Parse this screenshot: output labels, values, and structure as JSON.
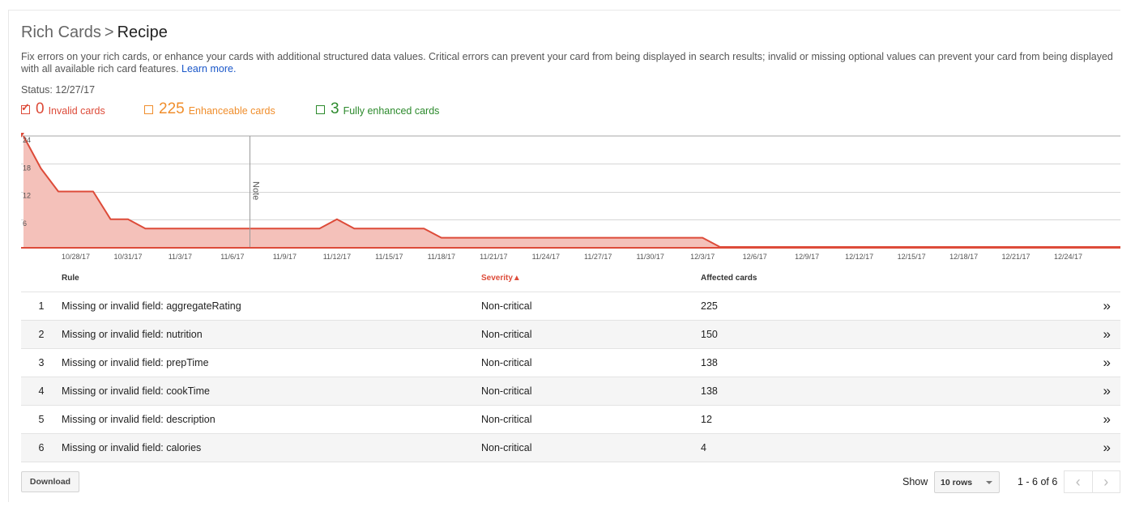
{
  "header": {
    "breadcrumb_parent": "Rich Cards",
    "breadcrumb_separator": ">",
    "title": "Recipe",
    "description": "Fix errors on your rich cards, or enhance your cards with additional structured data values. Critical errors can prevent your card from being displayed in search results; invalid or missing optional values can prevent your card from being displayed with all available rich card features.",
    "learn_more": "Learn more.",
    "status": "Status: 12/27/17"
  },
  "filters": [
    {
      "count": "0",
      "label": "Invalid cards",
      "checked": true,
      "color": "#dd4b39"
    },
    {
      "count": "225",
      "label": "Enhanceable cards",
      "checked": false,
      "color": "#f08e2c"
    },
    {
      "count": "3",
      "label": "Fully enhanced cards",
      "checked": false,
      "color": "#2c8a2c"
    }
  ],
  "chart_data": {
    "type": "area",
    "title": "",
    "xlabel": "",
    "ylabel": "",
    "ylim": [
      0,
      24
    ],
    "y_ticks": [
      "6",
      "12",
      "18",
      "24"
    ],
    "x_tick_labels": [
      "10/28/17",
      "10/31/17",
      "11/3/17",
      "11/6/17",
      "11/9/17",
      "11/12/17",
      "11/15/17",
      "11/18/17",
      "11/21/17",
      "11/24/17",
      "11/27/17",
      "11/30/17",
      "12/3/17",
      "12/6/17",
      "12/9/17",
      "12/12/17",
      "12/15/17",
      "12/18/17",
      "12/21/17",
      "12/24/17"
    ],
    "x": [
      "10/25/17",
      "10/26/17",
      "10/27/17",
      "10/28/17",
      "10/29/17",
      "10/30/17",
      "10/31/17",
      "11/1/17",
      "11/2/17",
      "11/3/17",
      "11/4/17",
      "11/5/17",
      "11/6/17",
      "11/7/17",
      "11/8/17",
      "11/9/17",
      "11/10/17",
      "11/11/17",
      "11/12/17",
      "11/13/17",
      "11/14/17",
      "11/15/17",
      "11/16/17",
      "11/17/17",
      "11/18/17",
      "11/19/17",
      "11/20/17",
      "11/21/17",
      "11/22/17",
      "11/23/17",
      "11/24/17",
      "11/25/17",
      "11/26/17",
      "11/27/17",
      "11/28/17",
      "11/29/17",
      "11/30/17",
      "12/1/17",
      "12/2/17",
      "12/3/17",
      "12/4/17",
      "12/5/17",
      "12/6/17",
      "12/7/17",
      "12/8/17",
      "12/9/17",
      "12/10/17",
      "12/11/17",
      "12/12/17",
      "12/13/17",
      "12/14/17",
      "12/15/17",
      "12/16/17",
      "12/17/17",
      "12/18/17",
      "12/19/17",
      "12/20/17",
      "12/21/17",
      "12/22/17",
      "12/23/17",
      "12/24/17",
      "12/25/17",
      "12/26/17",
      "12/27/17"
    ],
    "series": [
      {
        "name": "",
        "color": "#dd4b39",
        "values": [
          24,
          17,
          12,
          12,
          12,
          6,
          6,
          4,
          4,
          4,
          4,
          4,
          4,
          4,
          4,
          4,
          4,
          4,
          6,
          4,
          4,
          4,
          4,
          4,
          2,
          2,
          2,
          2,
          2,
          2,
          2,
          2,
          2,
          2,
          2,
          2,
          2,
          2,
          2,
          2,
          0,
          0,
          0,
          0,
          0,
          0,
          0,
          0,
          0,
          0,
          0,
          0,
          0,
          0,
          0,
          0,
          0,
          0,
          0,
          0,
          0,
          0,
          0,
          0
        ]
      }
    ],
    "annotation": {
      "label": "Note",
      "x": "11/7/17"
    },
    "grid": true
  },
  "table": {
    "columns": {
      "rule": "Rule",
      "severity": "Severity",
      "sort_indicator": "▲",
      "affected": "Affected cards"
    },
    "rows": [
      {
        "index": "1",
        "rule": "Missing or invalid field: aggregateRating",
        "severity": "Non-critical",
        "affected": "225"
      },
      {
        "index": "2",
        "rule": "Missing or invalid field: nutrition",
        "severity": "Non-critical",
        "affected": "150"
      },
      {
        "index": "3",
        "rule": "Missing or invalid field: prepTime",
        "severity": "Non-critical",
        "affected": "138"
      },
      {
        "index": "4",
        "rule": "Missing or invalid field: cookTime",
        "severity": "Non-critical",
        "affected": "138"
      },
      {
        "index": "5",
        "rule": "Missing or invalid field: description",
        "severity": "Non-critical",
        "affected": "12"
      },
      {
        "index": "6",
        "rule": "Missing or invalid field: calories",
        "severity": "Non-critical",
        "affected": "4"
      }
    ],
    "row_action_glyph": "»"
  },
  "footer": {
    "download_label": "Download",
    "show_label": "Show",
    "rows_select": "10 rows",
    "range_text": "1 - 6 of 6",
    "prev_glyph": "‹",
    "next_glyph": "›"
  },
  "colors": {
    "accent_red": "#dd4b39",
    "link": "#1a57c9"
  },
  "icons": {
    "checkbox": "checkbox-icon",
    "row_arrow": "double-chevron-right-icon",
    "select_caret": "caret-down-icon",
    "prev": "chevron-left-icon",
    "next": "chevron-right-icon"
  }
}
